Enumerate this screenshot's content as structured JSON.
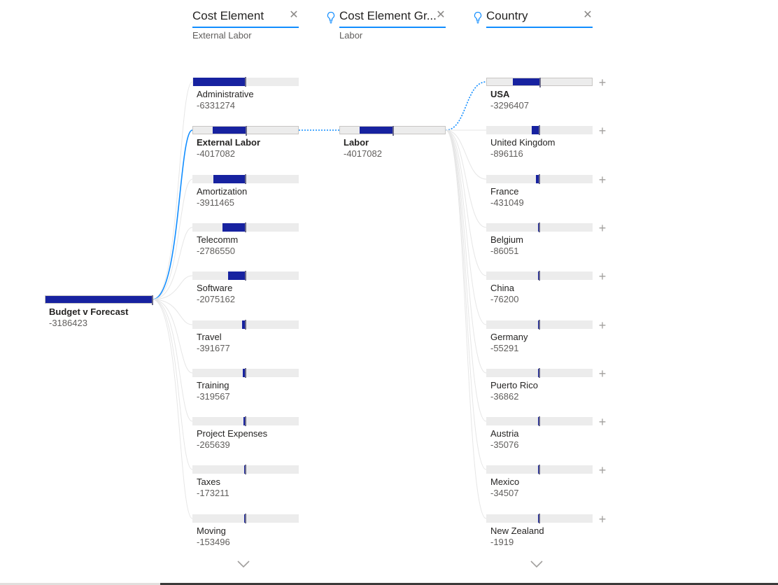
{
  "headers": [
    {
      "id": "cost-element",
      "title": "Cost Element",
      "subtitle": "External Labor",
      "close_icon": "close-icon",
      "has_bulb": false
    },
    {
      "id": "cost-element-group",
      "title": "Cost Element Gr...",
      "subtitle": "Labor",
      "close_icon": "close-icon",
      "has_bulb": true
    },
    {
      "id": "country",
      "title": "Country",
      "subtitle": "",
      "close_icon": "close-icon",
      "has_bulb": true
    }
  ],
  "root": {
    "label": "Budget v Forecast",
    "value": -3186423
  },
  "cost_elements": [
    {
      "label": "Administrative",
      "value": -6331274
    },
    {
      "label": "External Labor",
      "value": -4017082,
      "selected": true
    },
    {
      "label": "Amortization",
      "value": -3911465
    },
    {
      "label": "Telecomm",
      "value": -2786550
    },
    {
      "label": "Software",
      "value": -2075162
    },
    {
      "label": "Travel",
      "value": -391677
    },
    {
      "label": "Training",
      "value": -319567
    },
    {
      "label": "Project Expenses",
      "value": -265639
    },
    {
      "label": "Taxes",
      "value": -173211
    },
    {
      "label": "Moving",
      "value": -153496
    }
  ],
  "groups": [
    {
      "label": "Labor",
      "value": -4017082,
      "selected": true
    }
  ],
  "countries": [
    {
      "label": "USA",
      "value": -3296407,
      "selected": true
    },
    {
      "label": "United Kingdom",
      "value": -896116
    },
    {
      "label": "France",
      "value": -431049
    },
    {
      "label": "Belgium",
      "value": -86051
    },
    {
      "label": "China",
      "value": -76200
    },
    {
      "label": "Germany",
      "value": -55291
    },
    {
      "label": "Puerto Rico",
      "value": -36862
    },
    {
      "label": "Austria",
      "value": -35076
    },
    {
      "label": "Mexico",
      "value": -34507
    },
    {
      "label": "New Zealand",
      "value": -1919
    }
  ],
  "colors": {
    "bar_fill": "#1722a0",
    "track": "#ececec",
    "accent": "#118dff",
    "connector": "#e6e6e6"
  },
  "icons": {
    "expand": "plus-icon",
    "more": "chevron-down-icon",
    "ai_split": "lightbulb-icon"
  }
}
